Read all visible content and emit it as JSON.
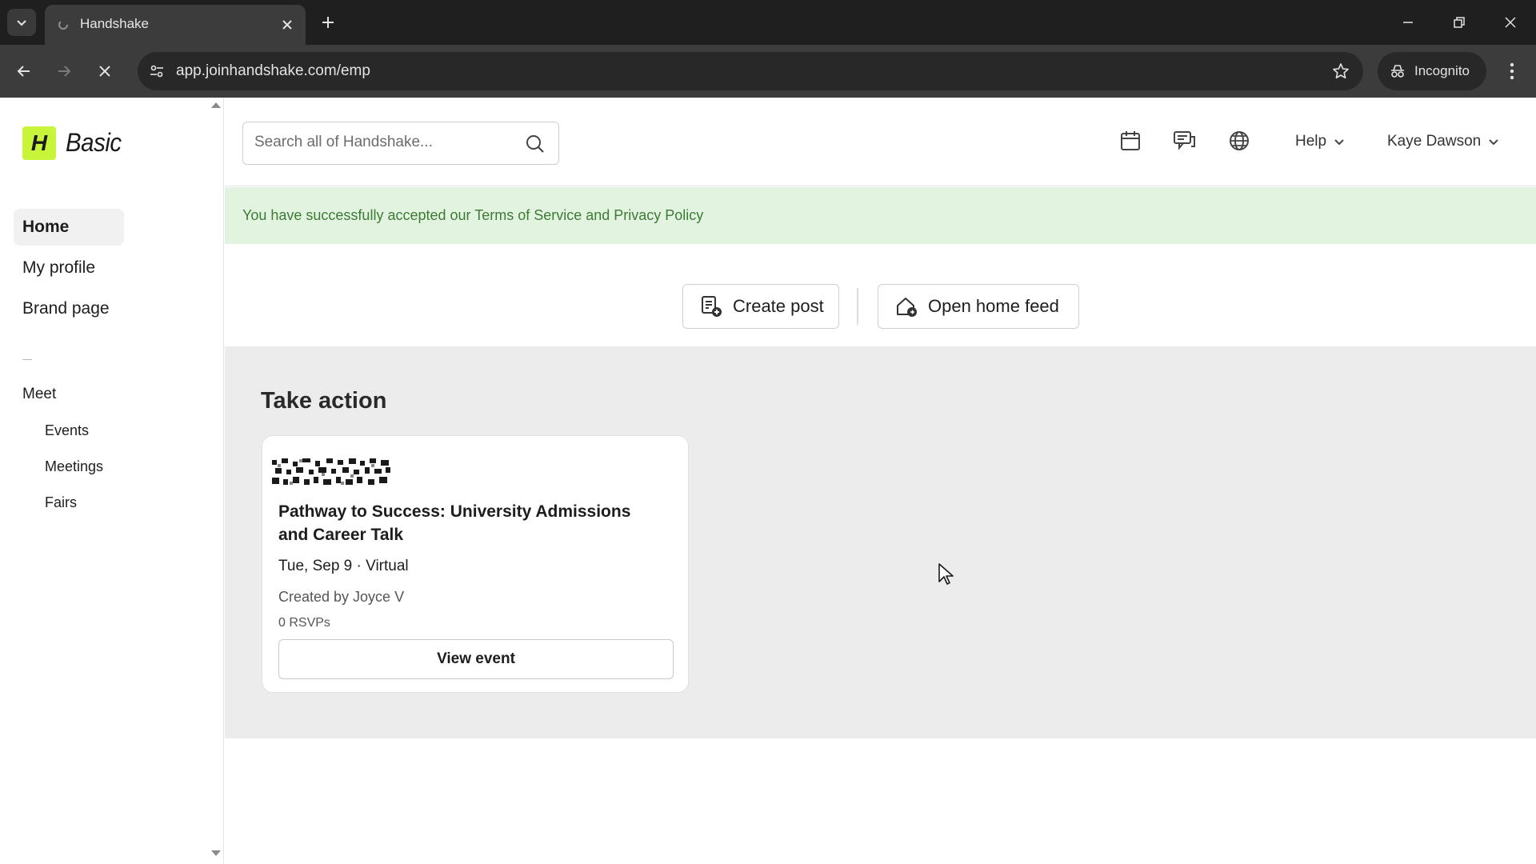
{
  "browser": {
    "tab_title": "Handshake",
    "url": "app.joinhandshake.com/emp",
    "incognito_label": "Incognito",
    "icons": [
      "tab-search-icon",
      "close-icon",
      "plus-icon",
      "minimize-icon",
      "restore-icon",
      "close-window-icon",
      "back-icon",
      "forward-icon",
      "stop-icon",
      "site-settings-icon",
      "star-icon",
      "incognito-icon",
      "kebab-icon"
    ]
  },
  "sidebar": {
    "logo_letter": "H",
    "logo_text": "Basic",
    "items": [
      {
        "label": "Home",
        "active": true
      },
      {
        "label": "My profile",
        "active": false
      },
      {
        "label": "Brand page",
        "active": false
      }
    ],
    "section": "Meet",
    "sub_items": [
      {
        "label": "Events"
      },
      {
        "label": "Meetings"
      },
      {
        "label": "Fairs"
      }
    ]
  },
  "header": {
    "search_placeholder": "Search all of Handshake...",
    "help_label": "Help",
    "user_name": "Kaye Dawson",
    "icons": [
      "calendar-icon",
      "messages-icon",
      "globe-icon"
    ]
  },
  "banner": {
    "text": "You have successfully accepted our Terms of Service and Privacy Policy",
    "color": "#3d7a37",
    "background": "#e2f4df"
  },
  "actions": {
    "create_post": "Create post",
    "open_home_feed": "Open home feed"
  },
  "main": {
    "section_title": "Take action",
    "event": {
      "title": "Pathway to Success: University Admissions and Career Talk",
      "meta": "Tue, Sep 9 · Virtual",
      "creator": "Created by Joyce V",
      "rsvps": "0 RSVPs",
      "button": "View event"
    }
  },
  "colors": {
    "brand_accent": "#c8f53a",
    "chrome_dark": "#1f1f1f",
    "main_background": "#ececec"
  }
}
